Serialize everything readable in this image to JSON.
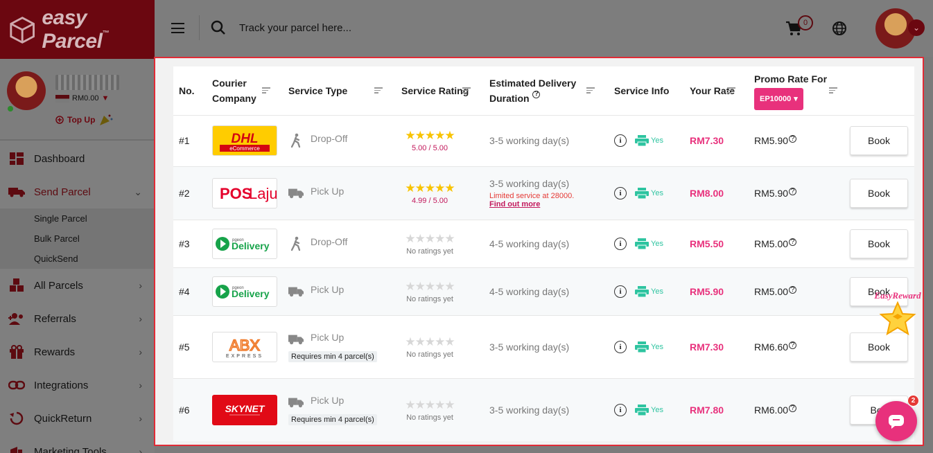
{
  "brand": {
    "name": "easy Parcel",
    "tm": "™"
  },
  "user": {
    "balance": "RM0.00",
    "topup_label": "Top Up"
  },
  "topbar": {
    "search_placeholder": "Track your parcel here...",
    "cart_count": "0"
  },
  "sidebar": {
    "items": [
      {
        "label": "Dashboard",
        "icon": "dashboard-icon"
      },
      {
        "label": "Send Parcel",
        "icon": "truck-icon",
        "active": true
      },
      {
        "label": "All Parcels",
        "icon": "boxes-icon"
      },
      {
        "label": "Referrals",
        "icon": "referrals-icon"
      },
      {
        "label": "Rewards",
        "icon": "gift-icon"
      },
      {
        "label": "Integrations",
        "icon": "link-icon"
      },
      {
        "label": "QuickReturn",
        "icon": "return-icon"
      },
      {
        "label": "Marketing Tools",
        "icon": "marketing-icon"
      }
    ],
    "sub_items": [
      {
        "label": "Single Parcel"
      },
      {
        "label": "Bulk Parcel"
      },
      {
        "label": "QuickSend"
      }
    ]
  },
  "table": {
    "headers": {
      "no": "No.",
      "courier": "Courier Company",
      "service_type": "Service Type",
      "service_rating": "Service Rating",
      "estimated": "Estimated Delivery Duration",
      "service_info": "Service Info",
      "your_rate": "Your Rate",
      "promo_for": "Promo Rate For",
      "promo_code": "EP10000"
    },
    "rows": [
      {
        "no": "#1",
        "courier": "DHL eCommerce",
        "service": "Drop-Off",
        "rating": "5.00 / 5.00",
        "rated": true,
        "duration": "3-5 working day(s)",
        "yes": "Yes",
        "rate": "RM7.30",
        "promo": "RM5.90",
        "book": "Book"
      },
      {
        "no": "#2",
        "courier": "POS Laju",
        "service": "Pick Up",
        "rating": "4.99 / 5.00",
        "rated": true,
        "duration": "3-5 working day(s)",
        "limited": "Limited service at 28000.",
        "findout": "Find out more",
        "yes": "Yes",
        "rate": "RM8.00",
        "promo": "RM5.90",
        "book": "Book"
      },
      {
        "no": "#3",
        "courier": "Pgeon Delivery",
        "service": "Drop-Off",
        "rating": "No ratings yet",
        "rated": false,
        "duration": "4-5 working day(s)",
        "yes": "Yes",
        "rate": "RM5.50",
        "promo": "RM5.00",
        "book": "Book"
      },
      {
        "no": "#4",
        "courier": "Pgeon Delivery",
        "service": "Pick Up",
        "rating": "No ratings yet",
        "rated": false,
        "duration": "4-5 working day(s)",
        "yes": "Yes",
        "rate": "RM5.90",
        "promo": "RM5.00",
        "book": "Book"
      },
      {
        "no": "#5",
        "courier": "ABX Express",
        "service": "Pick Up",
        "badge": "Requires min 4 parcel(s)",
        "rating": "No ratings yet",
        "rated": false,
        "duration": "3-5 working day(s)",
        "yes": "Yes",
        "rate": "RM7.30",
        "promo": "RM6.60",
        "book": "Book"
      },
      {
        "no": "#6",
        "courier": "SkyNet",
        "service": "Pick Up",
        "badge": "Requires min 4 parcel(s)",
        "rating": "No ratings yet",
        "rated": false,
        "duration": "3-5 working day(s)",
        "yes": "Yes",
        "rate": "RM7.80",
        "promo": "RM6.00",
        "book": "Boo"
      }
    ]
  },
  "widgets": {
    "reward_label": "EasyReward",
    "chat_badge": "2"
  },
  "colors": {
    "accent": "#e8317c",
    "brand": "#6b0710",
    "frame": "#e12b36"
  }
}
